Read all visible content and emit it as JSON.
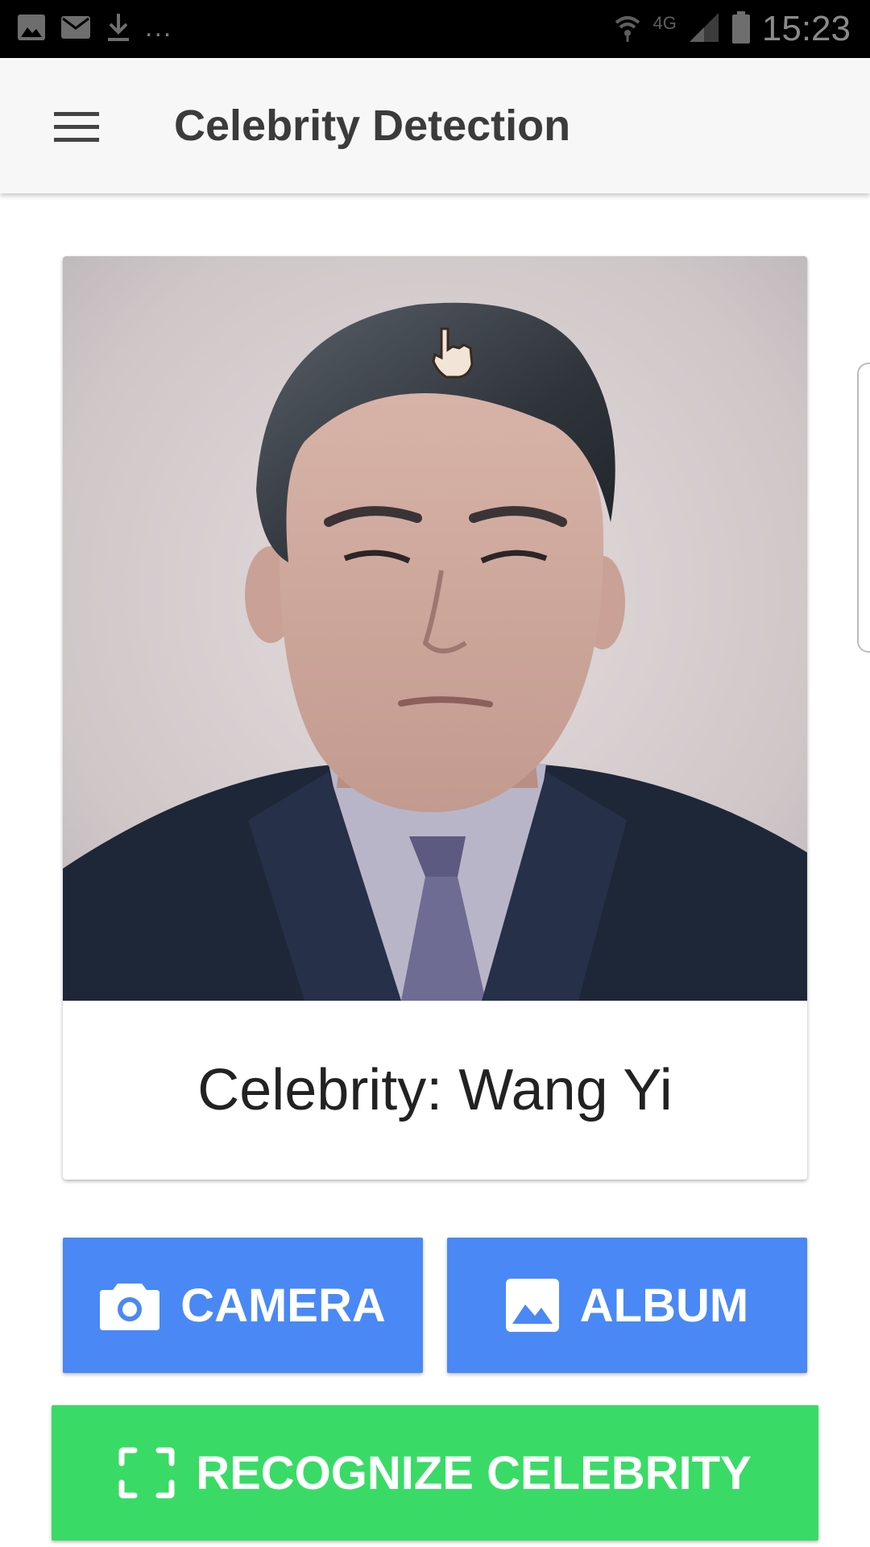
{
  "status_bar": {
    "time": "15:23",
    "notification_icons": [
      "image-icon",
      "mail-icon",
      "download-icon"
    ],
    "overflow_text": "...",
    "network_label": "4G",
    "right_icons": [
      "wifi-icon",
      "signal-icon",
      "battery-icon"
    ]
  },
  "app_bar": {
    "title": "Celebrity Detection",
    "menu_icon": "hamburger-menu-icon"
  },
  "result_card": {
    "image_alt": "Photo of detected person",
    "celebrity_text": "Celebrity: Wang Yi"
  },
  "buttons": {
    "camera_label": "CAMERA",
    "camera_icon": "camera-icon",
    "album_label": "ALBUM",
    "album_icon": "image-icon",
    "recognize_label": "RECOGNIZE CELEBRITY",
    "recognize_icon": "scan-frame-icon"
  },
  "colors": {
    "primary_button": "#4a88f5",
    "recognize_button": "#39db66",
    "app_bar": "#f7f7f7",
    "status_bar": "#000000"
  }
}
